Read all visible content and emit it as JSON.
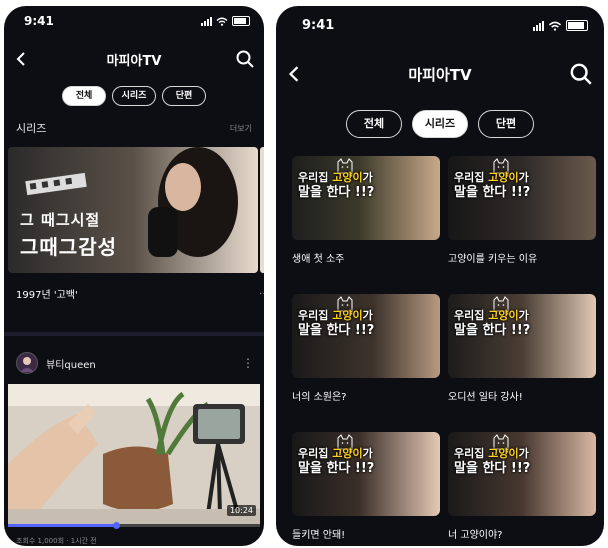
{
  "left": {
    "status": {
      "time": "9:41"
    },
    "nav": {
      "title": "마피아TV"
    },
    "tabs": [
      "전체",
      "시리즈",
      "단편"
    ],
    "section": {
      "title": "시리즈",
      "more": "더보기"
    },
    "series": {
      "title": "1997년 '고백'",
      "thumb_text_line1": "그 때그시절",
      "thumb_text_line2": "그때그감성",
      "peek_text": "…"
    },
    "channel": {
      "name": "뷰티queen",
      "more_icon": "⋮"
    },
    "video": {
      "duration": "10:24",
      "progress": 0.43,
      "meta": "조회수 1,000회 · 1시간 전"
    }
  },
  "right": {
    "status": {
      "time": "9:41"
    },
    "nav": {
      "title": "마피아TV"
    },
    "tabs": [
      "전체",
      "시리즈",
      "단편"
    ],
    "active_tab": "시리즈",
    "overlay": {
      "l1_pre": "우리집 ",
      "l1_hl": "고양이",
      "l1_post": "가",
      "l2": "말을 한다 !!?"
    },
    "videos": [
      {
        "title": "생애 첫 소주"
      },
      {
        "title": "고양이를 키우는 이유"
      },
      {
        "title": "너의 소원은?"
      },
      {
        "title": "오디션 일타 강사!"
      },
      {
        "title": "들키면 안돼!"
      },
      {
        "title": "너 고양이야?"
      }
    ]
  },
  "colors": {
    "background": "#0d0d14",
    "accent": "#5265ff",
    "highlight": "#ffd21e"
  }
}
